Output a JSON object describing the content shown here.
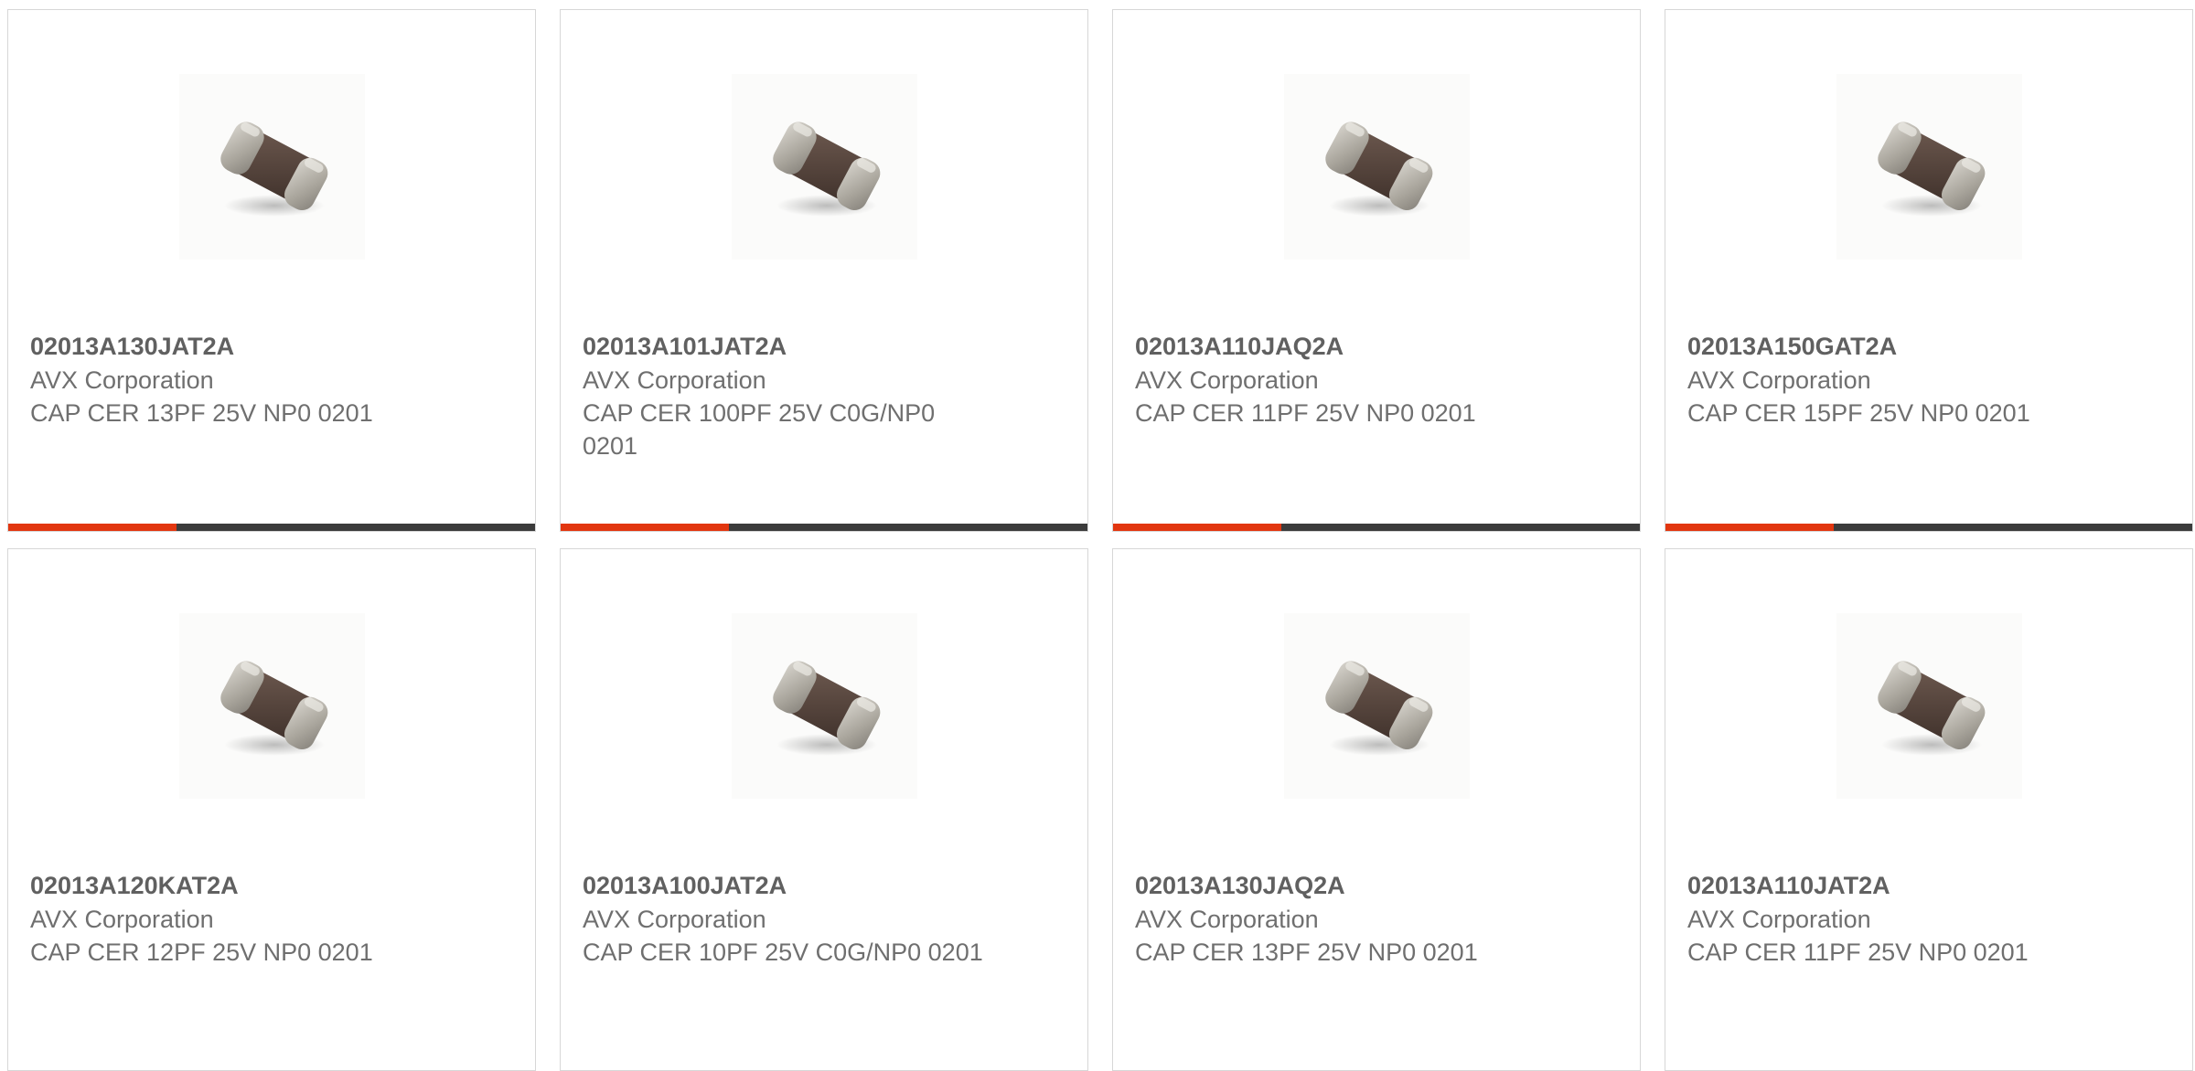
{
  "colors": {
    "accent": "#e2360f",
    "bar_track": "#3b3b3b",
    "border": "#d7d7d7",
    "text": "#6f6f6f"
  },
  "products": [
    {
      "part_number": "02013A130JAT2A",
      "manufacturer": "AVX Corporation",
      "description": "CAP CER 13PF 25V NP0 0201",
      "image_icon": "smd-capacitor-icon",
      "progress": 0.32
    },
    {
      "part_number": "02013A101JAT2A",
      "manufacturer": "AVX Corporation",
      "description": "CAP CER 100PF 25V C0G/NP0 0201",
      "image_icon": "smd-capacitor-icon",
      "progress": 0.32
    },
    {
      "part_number": "02013A110JAQ2A",
      "manufacturer": "AVX Corporation",
      "description": "CAP CER 11PF 25V NP0 0201",
      "image_icon": "smd-capacitor-icon",
      "progress": 0.32
    },
    {
      "part_number": "02013A150GAT2A",
      "manufacturer": "AVX Corporation",
      "description": "CAP CER 15PF 25V NP0 0201",
      "image_icon": "smd-capacitor-icon",
      "progress": 0.32
    },
    {
      "part_number": "02013A120KAT2A",
      "manufacturer": "AVX Corporation",
      "description": "CAP CER 12PF 25V NP0 0201",
      "image_icon": "smd-capacitor-icon"
    },
    {
      "part_number": "02013A100JAT2A",
      "manufacturer": "AVX Corporation",
      "description": "CAP CER 10PF 25V C0G/NP0 0201",
      "image_icon": "smd-capacitor-icon"
    },
    {
      "part_number": "02013A130JAQ2A",
      "manufacturer": "AVX Corporation",
      "description": "CAP CER 13PF 25V NP0 0201",
      "image_icon": "smd-capacitor-icon"
    },
    {
      "part_number": "02013A110JAT2A",
      "manufacturer": "AVX Corporation",
      "description": "CAP CER 11PF 25V NP0 0201",
      "image_icon": "smd-capacitor-icon"
    }
  ]
}
